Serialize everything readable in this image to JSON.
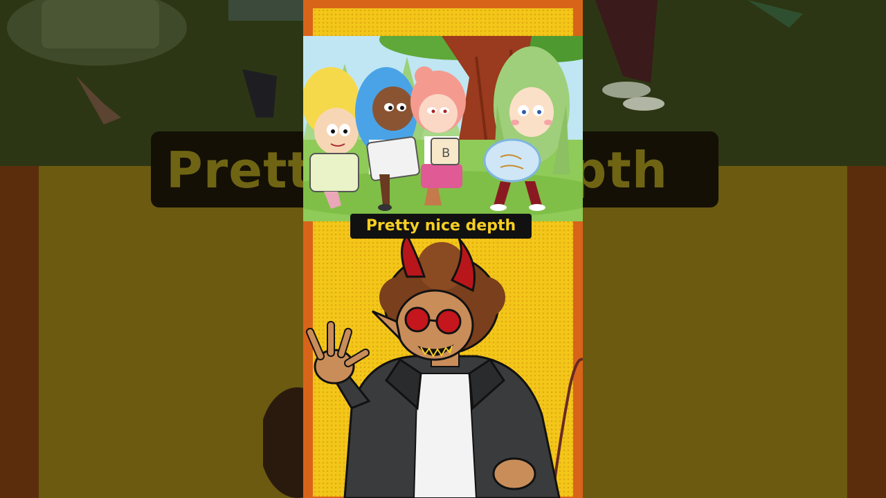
{
  "caption": {
    "text": "Pretty nice depth"
  },
  "colors": {
    "frame_border": "#d8641a",
    "frame_fill": "#f3c61a",
    "caption_bg": "#111111",
    "caption_text": "#f6cf22",
    "sky": "#bfe6f2",
    "grass": "#8fcb58",
    "devil_horn": "#b8161b",
    "jacket": "#3a3b3d"
  },
  "scene": {
    "cartoon_clip": "four cartoon girls holding pillows under a tree",
    "character": "devil host with horns, red glasses, jacket, and tail"
  }
}
